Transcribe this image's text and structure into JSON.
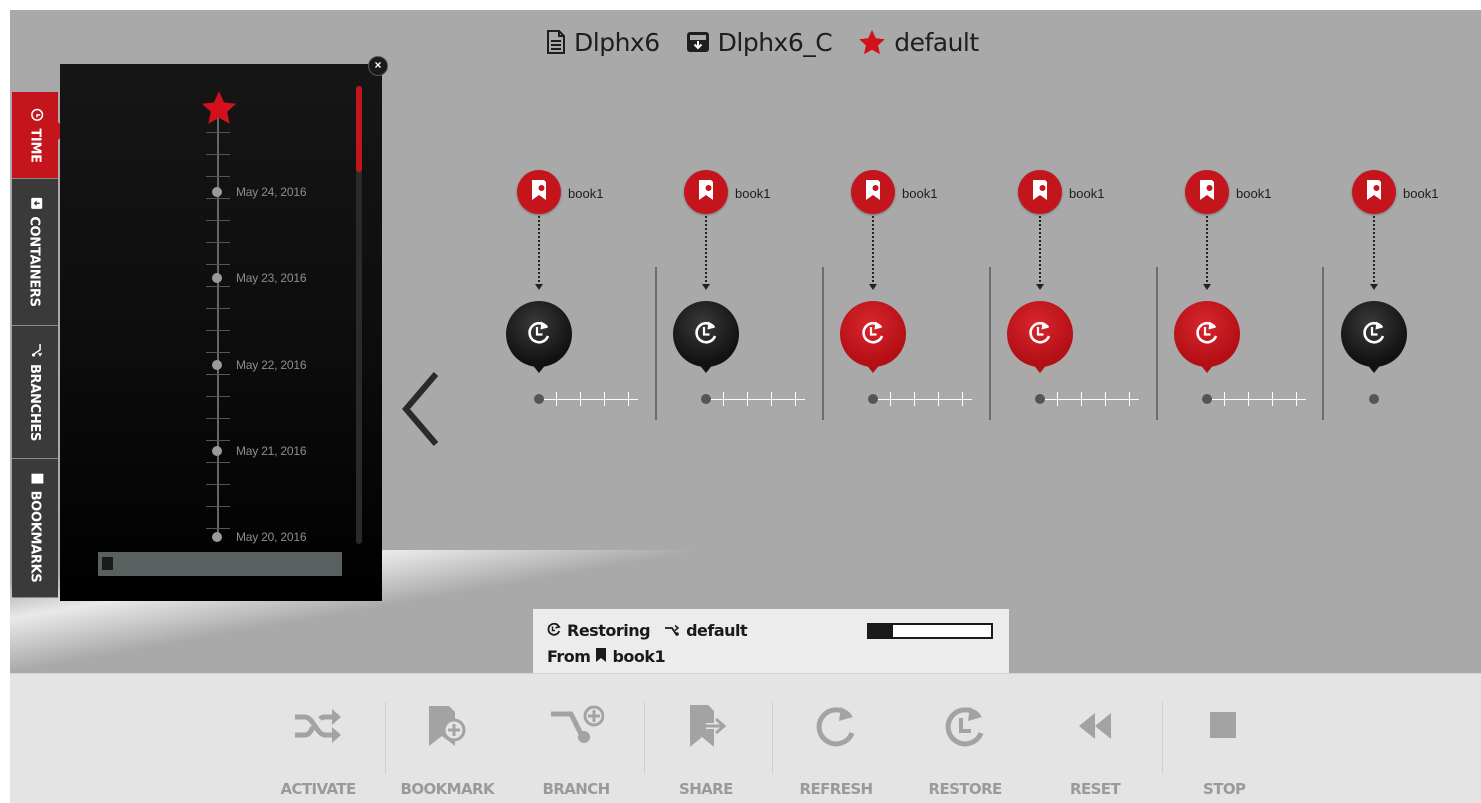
{
  "header": {
    "items": [
      {
        "icon": "document-icon",
        "label": "Dlphx6"
      },
      {
        "icon": "container-icon",
        "label": "Dlphx6_C"
      },
      {
        "icon": "star-icon",
        "label": "default"
      }
    ]
  },
  "side_tabs": [
    {
      "label": "TIME",
      "icon": "clock-icon",
      "active": true
    },
    {
      "label": "CONTAINERS",
      "icon": "container-icon",
      "active": false
    },
    {
      "label": "BRANCHES",
      "icon": "branch-icon",
      "active": false
    },
    {
      "label": "BOOKMARKS",
      "icon": "bookmark-icon",
      "active": false
    }
  ],
  "time_panel": {
    "close_label": "×",
    "dates": [
      "May 24, 2016",
      "May 23, 2016",
      "May 22, 2016",
      "May 21, 2016",
      "May 20, 2016"
    ]
  },
  "snapshots": [
    {
      "bookmark": "book1",
      "state": "black"
    },
    {
      "bookmark": "book1",
      "state": "black"
    },
    {
      "bookmark": "book1",
      "state": "red"
    },
    {
      "bookmark": "book1",
      "state": "red"
    },
    {
      "bookmark": "book1",
      "state": "red"
    },
    {
      "bookmark": "book1",
      "state": "black"
    }
  ],
  "status": {
    "action": "Restoring",
    "branch": "default",
    "from_label": "From",
    "bookmark": "book1",
    "progress": 0.2
  },
  "toolbar": {
    "items": [
      {
        "label": "ACTIVATE",
        "icon": "shuffle-icon"
      },
      {
        "label": "BOOKMARK",
        "icon": "bookmark-add-icon"
      },
      {
        "label": "BRANCH",
        "icon": "branch-add-icon"
      },
      {
        "label": "SHARE",
        "icon": "share-icon"
      },
      {
        "label": "REFRESH",
        "icon": "refresh-icon"
      },
      {
        "label": "RESTORE",
        "icon": "restore-icon"
      },
      {
        "label": "RESET",
        "icon": "rewind-icon"
      },
      {
        "label": "STOP",
        "icon": "stop-icon"
      }
    ]
  },
  "colors": {
    "accent": "#c4141c",
    "stage_bg": "#a9a9a9",
    "toolbar_bg": "#e4e4e4",
    "toolbar_text": "#9a9a9a",
    "panel_bg": "#0c0c0c"
  }
}
